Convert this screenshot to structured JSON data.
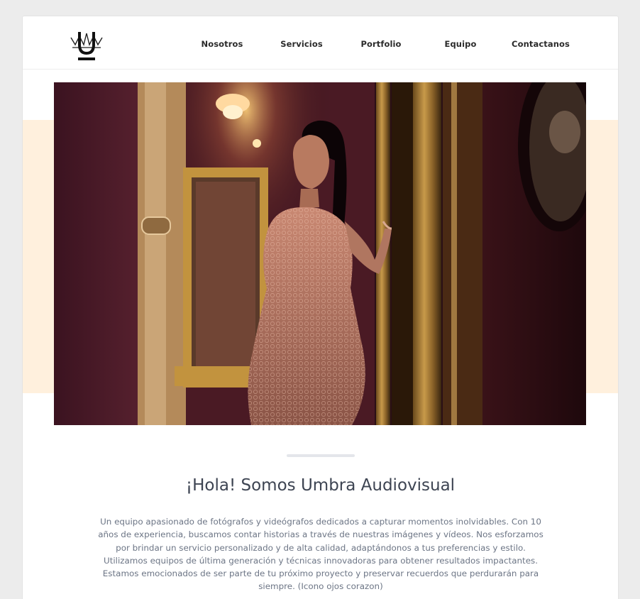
{
  "brand": {
    "logo_name": "umbra-crown-logo"
  },
  "nav": {
    "items": [
      {
        "label": "Nosotros"
      },
      {
        "label": "Servicios"
      },
      {
        "label": "Portfolio"
      },
      {
        "label": "Equipo"
      },
      {
        "label": "Contactanos"
      }
    ]
  },
  "hero": {
    "image_name": "hero-photo"
  },
  "about": {
    "title": "¡Hola! Somos Umbra Audiovisual",
    "body": "Un equipo apasionado de fotógrafos y videógrafos dedicados a capturar momentos inolvidables. Con 10 años de experiencia, buscamos contar historias a través de nuestras imágenes y vídeos. Nos esforzamos por brindar un servicio personalizado y de alta calidad, adaptándonos a tus preferencias y estilo. Utilizamos equipos de última generación y técnicas innovadoras para obtener resultados impactantes. Estamos emocionados de ser parte de tu próximo proyecto y preservar recuerdos que perdurarán para siempre. (Icono ojos corazon)"
  },
  "colors": {
    "page_background": "#ececec",
    "card_background": "#ffffff",
    "peach_band": "#fff0dd",
    "nav_text": "#2b2b2b",
    "headline_text": "#3d4452",
    "body_text": "#6c7585"
  }
}
